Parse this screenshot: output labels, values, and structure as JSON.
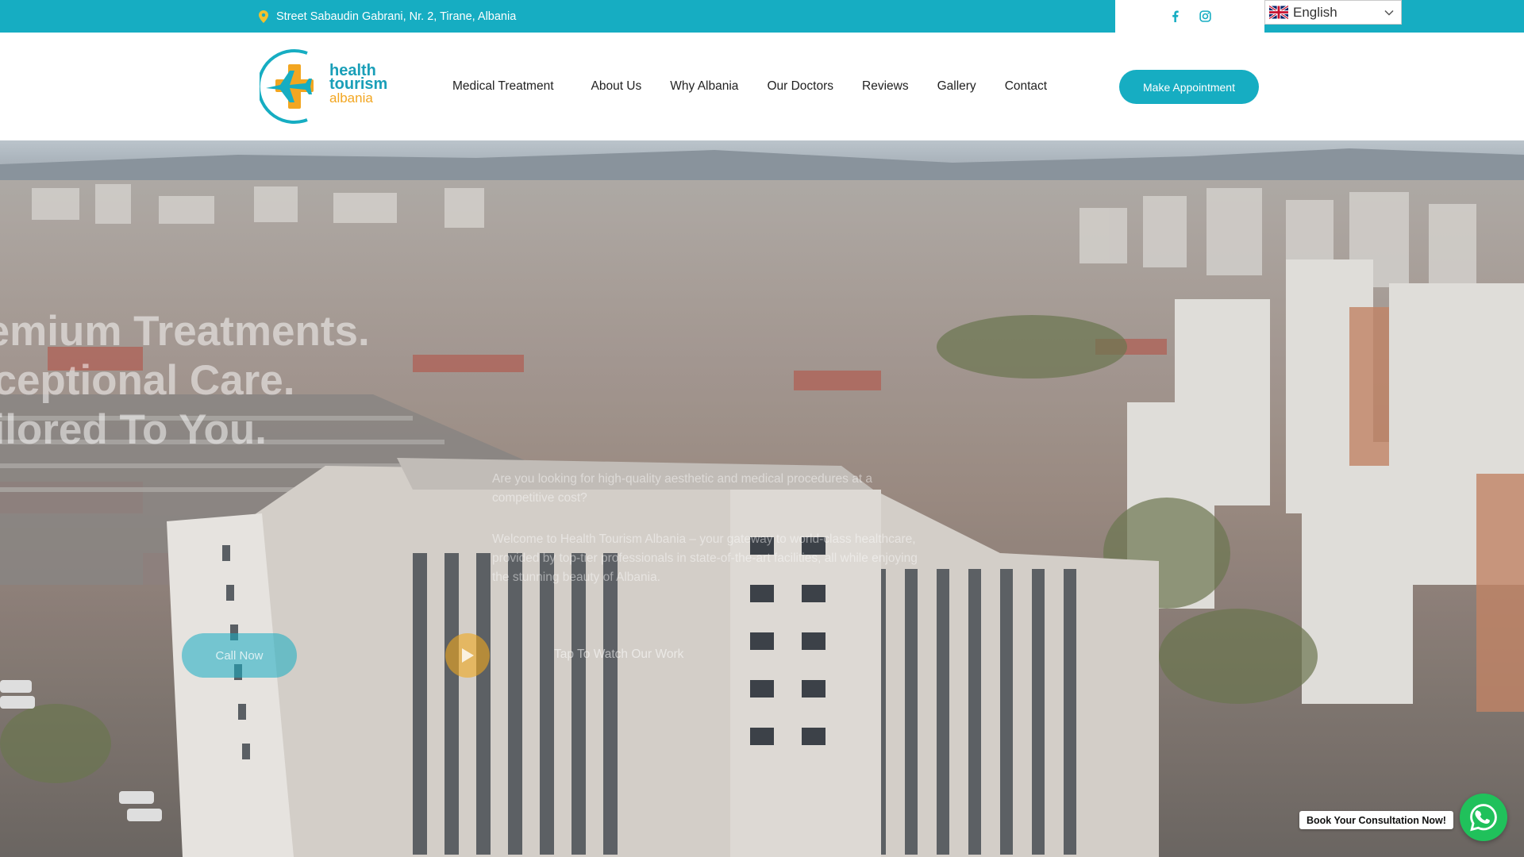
{
  "topbar": {
    "address": "Street Sabaudin Gabrani, Nr. 2, Tirane, Albania",
    "address_icon": "map-pin-icon",
    "social": [
      "facebook-icon",
      "instagram-icon"
    ],
    "language": "English",
    "language_flag": "uk-flag-icon"
  },
  "header": {
    "logo": {
      "line1": "health",
      "line2": "tourism",
      "line3": "albania"
    },
    "nav": [
      "Medical Treatment",
      "About Us",
      "Why Albania",
      "Our Doctors",
      "Reviews",
      "Gallery",
      "Contact"
    ],
    "cta_label": "Make Appointment"
  },
  "hero": {
    "headline": [
      "remium Treatments.",
      "xceptional Care.",
      "ailored To You."
    ],
    "subtitle": "Are you looking for high-quality aesthetic and medical procedures at a competitive cost?",
    "body": "Welcome to Health Tourism Albania – your gateway to world-class healthcare, provided by top-tier professionals in state-of-the-art facilities, all while enjoying the stunning beauty of Albania.",
    "call_label": "Call Now",
    "watch_label": "Tap To Watch Our Work"
  },
  "floating": {
    "consult_label": "Book Your Consultation Now!",
    "whatsapp_icon": "whatsapp-icon"
  },
  "colors": {
    "brand_teal": "#16adc2",
    "brand_orange": "#f2a621",
    "whatsapp_green": "#20c15b"
  }
}
